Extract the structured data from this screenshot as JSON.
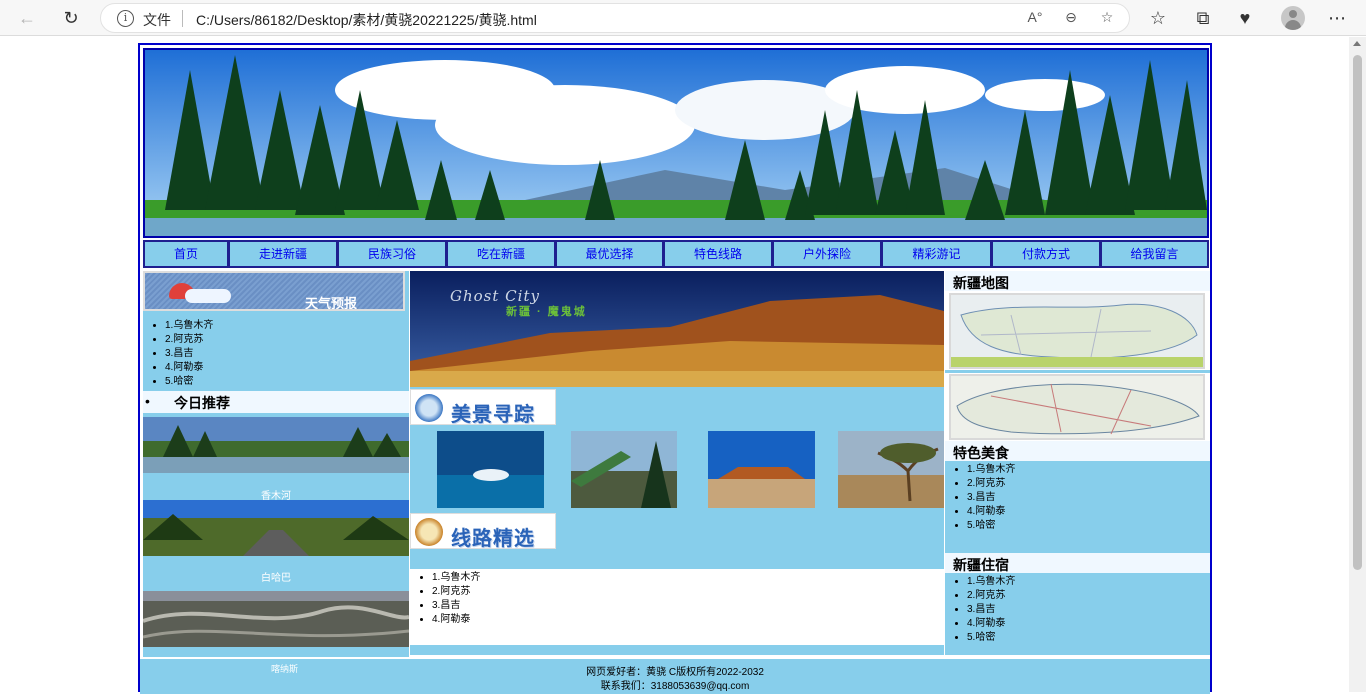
{
  "browser": {
    "file_label": "文件",
    "url": "C:/Users/86182/Desktop/素材/黄骁20221225/黄骁.html"
  },
  "menu": [
    "首页",
    "走进新疆",
    "民族习俗",
    "吃在新疆",
    "最优选择",
    "特色线路",
    "户外探险",
    "精彩游记",
    "付款方式",
    "给我留言"
  ],
  "left": {
    "weather_title": "天气预报",
    "cities": [
      "1.乌鲁木齐",
      "2.阿克苏",
      "3.昌吉",
      "4.阿勒泰",
      "5.哈密"
    ],
    "today_title": "今日推荐",
    "photo_captions": [
      "喀纳斯",
      "香木河",
      "白哈巴"
    ]
  },
  "center": {
    "banner_en": "Ghost City",
    "banner_cn": "新疆 · 魔鬼城",
    "scenic_title": "美景寻踪",
    "route_title": "线路精选",
    "routes": [
      "1.乌鲁木齐",
      "2.阿克苏",
      "3.昌吉",
      "4.阿勒泰"
    ]
  },
  "right": {
    "map_title": "新疆地图",
    "food_title": "特色美食",
    "food_list": [
      "1.乌鲁木齐",
      "2.阿克苏",
      "3.昌吉",
      "4.阿勒泰",
      "5.哈密"
    ],
    "stay_title": "新疆住宿",
    "stay_list": [
      "1.乌鲁木齐",
      "2.阿克苏",
      "3.昌吉",
      "4.阿勒泰",
      "5.哈密"
    ]
  },
  "footer": {
    "line1": "网页爱好者：黄骁 C版权所有2022-2032",
    "line2": "联系我们：3188053639@qq.com"
  },
  "colors": {
    "sky_blue": "#87ceeb",
    "border_blue": "#0000cc",
    "link_blue": "#0000ee"
  }
}
